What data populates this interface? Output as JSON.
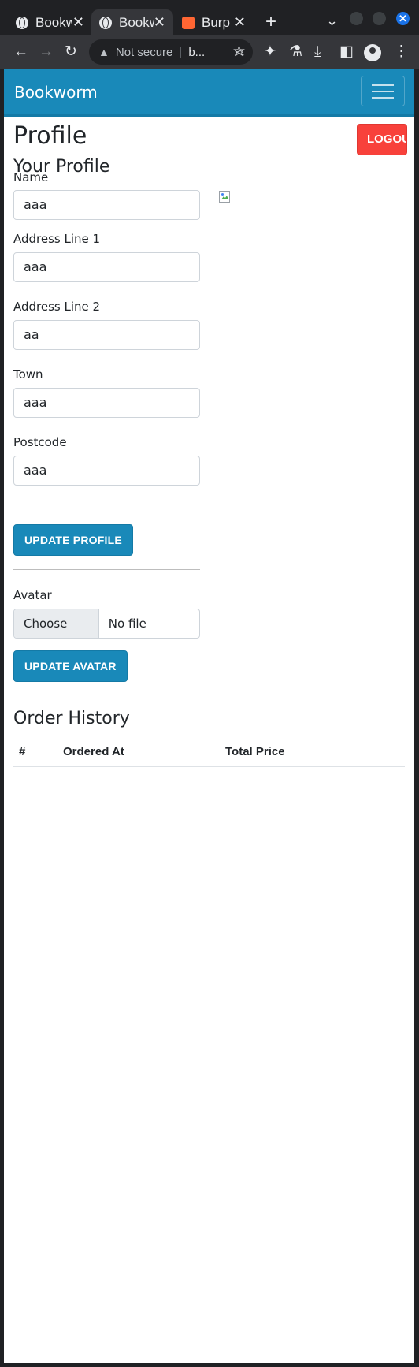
{
  "browser": {
    "tabs": [
      {
        "title": "Bookworm",
        "favicon": "globe-icon"
      },
      {
        "title": "Bookworm",
        "favicon": "globe-icon"
      },
      {
        "title": "Burp Suite",
        "favicon": "burp-icon"
      }
    ],
    "omnibox": {
      "security": "Not secure",
      "url": "b..."
    }
  },
  "navbar": {
    "brand": "Bookworm"
  },
  "page": {
    "logout_label": "LOGOUT",
    "title": "Profile",
    "subtitle": "Your Profile",
    "fields": [
      {
        "label": "Name",
        "value": "aaa"
      },
      {
        "label": "Address Line 1",
        "value": "aaa"
      },
      {
        "label": "Address Line 2",
        "value": "aa"
      },
      {
        "label": "Town",
        "value": "aaa"
      },
      {
        "label": "Postcode",
        "value": "aaa"
      }
    ],
    "update_profile_label": "UPDATE PROFILE",
    "avatar": {
      "label": "Avatar",
      "choose_label": "Choose File",
      "status": "No file chosen"
    },
    "update_avatar_label": "UPDATE AVATAR",
    "orders": {
      "title": "Order History",
      "columns": [
        "#",
        "Ordered At",
        "Total Price"
      ],
      "rows": []
    }
  },
  "colors": {
    "brand": "#1989b9",
    "logout": "#f8413b"
  }
}
